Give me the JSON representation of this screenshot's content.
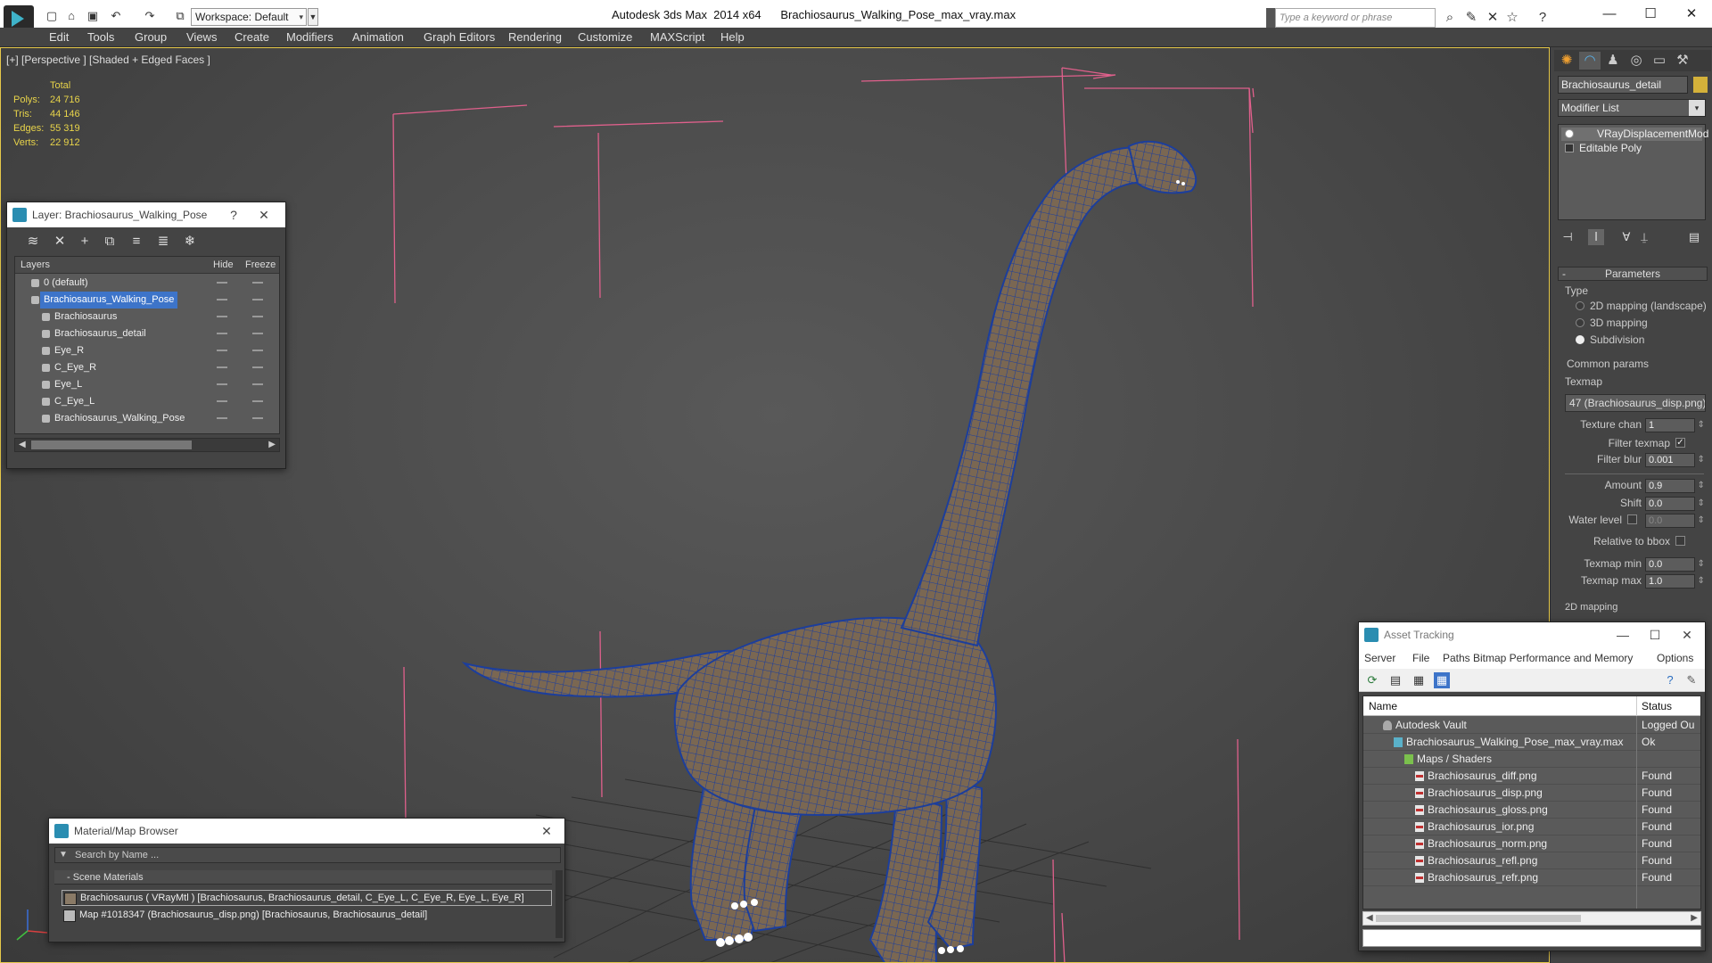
{
  "titlebar": {
    "workspace": "Workspace: Default",
    "app_title": "Autodesk 3ds Max  2014 x64",
    "file_title": "Brachiosaurus_Walking_Pose_max_vray.max",
    "search_placeholder": "Type a keyword or phrase"
  },
  "menu": [
    "Edit",
    "Tools",
    "Group",
    "Views",
    "Create",
    "Modifiers",
    "Animation",
    "Graph Editors",
    "Rendering",
    "Customize",
    "MAXScript",
    "Help"
  ],
  "viewport": {
    "label": "[+] [Perspective ] [Shaded + Edged Faces ]",
    "stats": {
      "header": "Total",
      "rows": [
        {
          "label": "Polys:",
          "value": "24 716"
        },
        {
          "label": "Tris:",
          "value": "44 146"
        },
        {
          "label": "Edges:",
          "value": "55 319"
        },
        {
          "label": "Verts:",
          "value": "22 912"
        }
      ]
    },
    "colors": {
      "wire": "#1c3e9c",
      "skin": "#7d6a55",
      "bbox": "#e0608c",
      "teeth": "#ffffff",
      "border": "#e6c84a"
    }
  },
  "command_panel": {
    "object_name": "Brachiosaurus_detail",
    "modifier_list": "Modifier List",
    "stack": [
      "VRayDisplacementMod",
      "Editable Poly"
    ],
    "parameters_title": "Parameters",
    "type_label": "Type",
    "type_options": [
      {
        "label": "2D mapping (landscape)",
        "selected": false
      },
      {
        "label": "3D mapping",
        "selected": false
      },
      {
        "label": "Subdivision",
        "selected": true
      }
    ],
    "common_params": "Common params",
    "texmap_label": "Texmap",
    "texmap_value": "47 (Brachiosaurus_disp.png)",
    "texture_chan_label": "Texture chan",
    "texture_chan": "1",
    "filter_texmap_label": "Filter texmap",
    "filter_texmap_checked": true,
    "filter_blur_label": "Filter blur",
    "filter_blur": "0.001",
    "amount_label": "Amount",
    "amount": "0.9",
    "shift_label": "Shift",
    "shift": "0.0",
    "water_level_label": "Water level",
    "water_level": "0.0",
    "relative_bbox_label": "Relative to bbox",
    "texmap_min_label": "Texmap min",
    "texmap_min": "0.0",
    "texmap_max_label": "Texmap max",
    "texmap_max": "1.0",
    "mapping_2d": "2D mapping"
  },
  "layer_window": {
    "title": "Layer: Brachiosaurus_Walking_Pose",
    "help": "?",
    "headers": {
      "layers": "Layers",
      "hide": "Hide",
      "freeze": "Freeze"
    },
    "rows": [
      {
        "name": "0 (default)",
        "indent": 1,
        "selected": false
      },
      {
        "name": "Brachiosaurus_Walking_Pose",
        "indent": 0,
        "selected": true
      },
      {
        "name": "Brachiosaurus",
        "indent": 2,
        "selected": false
      },
      {
        "name": "Brachiosaurus_detail",
        "indent": 2,
        "selected": false
      },
      {
        "name": "Eye_R",
        "indent": 2,
        "selected": false
      },
      {
        "name": "C_Eye_R",
        "indent": 2,
        "selected": false
      },
      {
        "name": "Eye_L",
        "indent": 2,
        "selected": false
      },
      {
        "name": "C_Eye_L",
        "indent": 2,
        "selected": false
      },
      {
        "name": "Brachiosaurus_Walking_Pose",
        "indent": 2,
        "selected": false
      }
    ]
  },
  "material_browser": {
    "title": "Material/Map Browser",
    "search_placeholder": "Search by Name ...",
    "section": "- Scene Materials",
    "items": [
      "Brachiosaurus  ( VRayMtl ) [Brachiosaurus, Brachiosaurus_detail, C_Eye_L, C_Eye_R, Eye_L, Eye_R]",
      "Map #1018347 (Brachiosaurus_disp.png) [Brachiosaurus, Brachiosaurus_detail]"
    ]
  },
  "asset_tracking": {
    "title": "Asset Tracking",
    "menu": [
      "Server",
      "File",
      "Paths",
      "Bitmap Performance and Memory",
      "Options"
    ],
    "headers": {
      "name": "Name",
      "status": "Status"
    },
    "rows": [
      {
        "name": "Autodesk Vault",
        "status": "Logged Ou",
        "indent": 1,
        "icon": "vault"
      },
      {
        "name": "Brachiosaurus_Walking_Pose_max_vray.max",
        "status": "Ok",
        "indent": 2,
        "icon": "max"
      },
      {
        "name": "Maps / Shaders",
        "status": "",
        "indent": 3,
        "icon": "fold"
      },
      {
        "name": "Brachiosaurus_diff.png",
        "status": "Found",
        "indent": 4,
        "icon": "png"
      },
      {
        "name": "Brachiosaurus_disp.png",
        "status": "Found",
        "indent": 4,
        "icon": "png"
      },
      {
        "name": "Brachiosaurus_gloss.png",
        "status": "Found",
        "indent": 4,
        "icon": "png"
      },
      {
        "name": "Brachiosaurus_ior.png",
        "status": "Found",
        "indent": 4,
        "icon": "png"
      },
      {
        "name": "Brachiosaurus_norm.png",
        "status": "Found",
        "indent": 4,
        "icon": "png"
      },
      {
        "name": "Brachiosaurus_refl.png",
        "status": "Found",
        "indent": 4,
        "icon": "png"
      },
      {
        "name": "Brachiosaurus_refr.png",
        "status": "Found",
        "indent": 4,
        "icon": "png"
      }
    ]
  }
}
